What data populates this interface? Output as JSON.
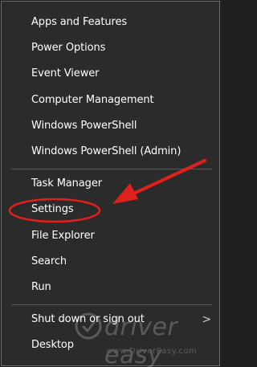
{
  "menu": {
    "items": [
      {
        "label": "Apps and Features"
      },
      {
        "label": "Power Options"
      },
      {
        "label": "Event Viewer"
      },
      {
        "label": "Computer Management"
      },
      {
        "label": "Windows PowerShell"
      },
      {
        "label": "Windows PowerShell (Admin)"
      },
      {
        "label": "Task Manager"
      },
      {
        "label": "Settings"
      },
      {
        "label": "File Explorer"
      },
      {
        "label": "Search"
      },
      {
        "label": "Run"
      },
      {
        "label": "Shut down or sign out"
      },
      {
        "label": "Desktop"
      }
    ],
    "submenu_chevron": ">"
  },
  "watermark": {
    "brand": "driver easy",
    "url": "www.DriverEasy.com"
  },
  "colors": {
    "background": "#2b2b2b",
    "text": "#ffffff",
    "annotation": "#e0201b"
  },
  "icons": {
    "watermark_logo": "driver-easy-logo-icon",
    "annotation_arrow": "red-arrow-icon",
    "annotation_circle": "red-ellipse-highlight-icon"
  }
}
